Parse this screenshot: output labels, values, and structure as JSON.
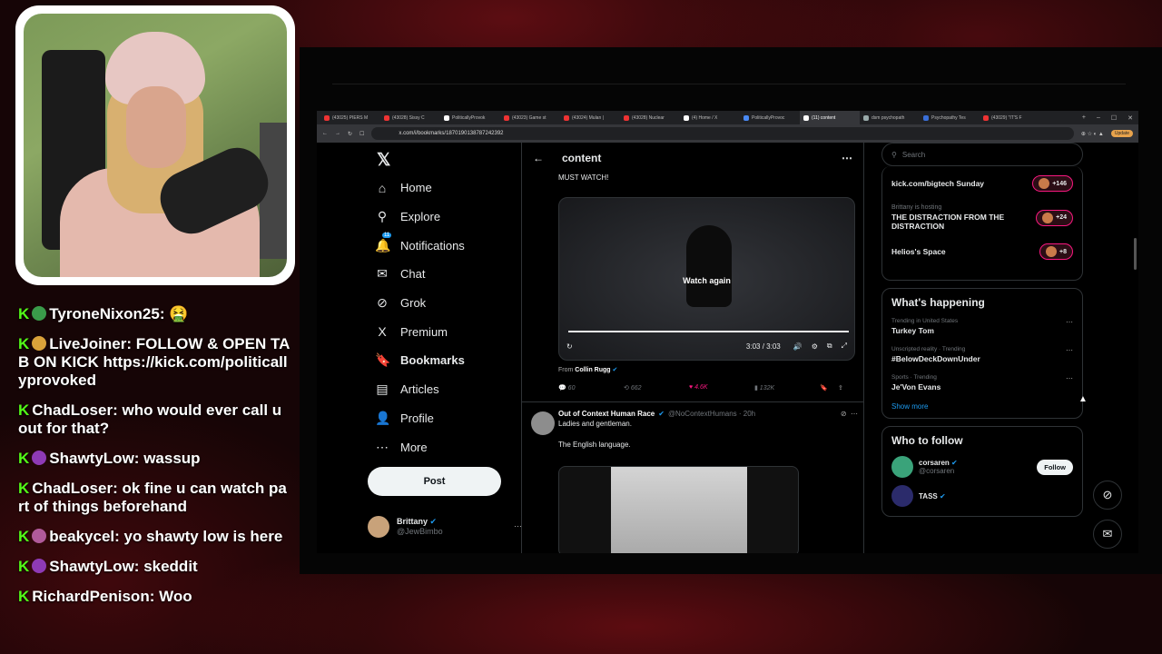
{
  "chat": [
    {
      "user": "TyroneNixon25",
      "text": "🤮",
      "emoji_color": "#3a9b4a"
    },
    {
      "user": "LiveJoiner",
      "text": "FOLLOW & OPEN TAB ON KICK https://kick.com/politicallyprovoked",
      "emoji_color": "#d9a23a"
    },
    {
      "user": "ChadLoser",
      "text": "who would ever call u out for that?",
      "emoji_color": ""
    },
    {
      "user": "ShawtyLow",
      "text": "wassup",
      "emoji_color": "#8e3ab5"
    },
    {
      "user": "ChadLoser",
      "text": "ok fine u can watch part of things beforehand",
      "emoji_color": ""
    },
    {
      "user": "beakycel",
      "text": "yo shawty low is here",
      "emoji_color": "#b05a9a"
    },
    {
      "user": "ShawtyLow",
      "text": "skeddit",
      "emoji_color": "#8e3ab5"
    },
    {
      "user": "RichardPenison",
      "text": "Woo",
      "emoji_color": ""
    }
  ],
  "browser": {
    "tabs": [
      "(43025) PIERS M",
      "(43028) Sissy C",
      "PoliticallyProvok",
      "(43023) Game st",
      "(43024) Mulan |",
      "(43028) Nuclear",
      "(4) Home / X",
      "PoliticallyProvoc",
      "(11) content",
      "dsm psychopath",
      "Psychopathy Tes",
      "(43029) \"IT'S F"
    ],
    "url": "x.com/i/bookmarks/1870190138787242392",
    "update_label": "Update"
  },
  "nav": {
    "items": [
      {
        "label": "Home",
        "icon": "⌂"
      },
      {
        "label": "Explore",
        "icon": "⚲"
      },
      {
        "label": "Notifications",
        "icon": "🔔"
      },
      {
        "label": "Chat",
        "icon": "✉"
      },
      {
        "label": "Grok",
        "icon": "⊘"
      },
      {
        "label": "Premium",
        "icon": "X"
      },
      {
        "label": "Bookmarks",
        "icon": "🔖"
      },
      {
        "label": "Articles",
        "icon": "▤"
      },
      {
        "label": "Profile",
        "icon": "👤"
      },
      {
        "label": "More",
        "icon": "⋯"
      }
    ],
    "notif_badge": "11",
    "post_label": "Post",
    "user_name": "Brittany",
    "user_handle": "@JewBimbo"
  },
  "main": {
    "title": "content",
    "must_watch": "MUST WATCH!",
    "watch_again": "Watch again",
    "video_time": "3:03 / 3:03",
    "from_label": "From",
    "from_name": "Collin Rugg",
    "stats": {
      "replies": "60",
      "reposts": "662",
      "likes": "4.6K",
      "views": "132K"
    },
    "tweet2": {
      "name": "Out of Context Human Race",
      "handle": "@NoContextHumans · 20h",
      "line1": "Ladies and gentleman.",
      "line2": "The English language."
    }
  },
  "right": {
    "search_placeholder": "Search",
    "spaces": [
      {
        "meta": "",
        "title": "kick.com/bigtech Sunday",
        "count": "+146"
      },
      {
        "meta": "Brittany is hosting",
        "title": "THE DISTRACTION FROM THE DISTRACTION",
        "count": "+24"
      },
      {
        "meta": "",
        "title": "Helios's Space",
        "count": "+8"
      }
    ],
    "happening_title": "What's happening",
    "trends": [
      {
        "meta": "Trending in United States",
        "name": "Turkey Tom"
      },
      {
        "meta": "Unscripted reality · Trending",
        "name": "#BelowDeckDownUnder"
      },
      {
        "meta": "Sports · Trending",
        "name": "Je'Von Evans"
      }
    ],
    "show_more": "Show more",
    "who_title": "Who to follow",
    "follows": [
      {
        "name": "corsaren",
        "handle": "@corsaren",
        "btn": "Follow"
      },
      {
        "name": "TASS",
        "handle": "",
        "btn": ""
      }
    ]
  }
}
